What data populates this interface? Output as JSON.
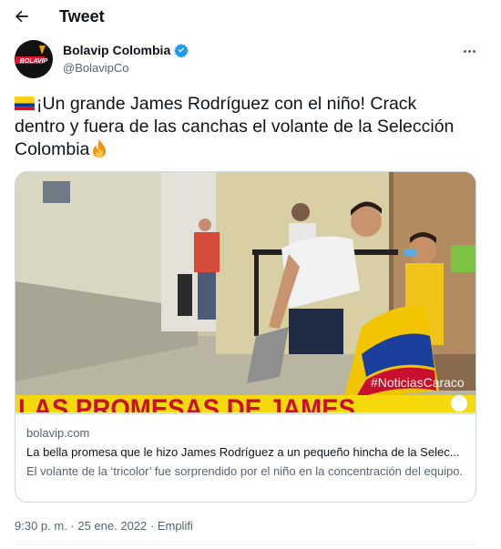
{
  "header": {
    "title": "Tweet",
    "back_icon": "arrow-left-icon"
  },
  "author": {
    "name": "Bolavip Colombia",
    "handle": "@BolavipCo",
    "verified_icon": "verified-badge-icon",
    "avatar_text": "BOLAVIP",
    "colors": {
      "verified": "#1d9bf0",
      "avatar_bg": "#111111",
      "avatar_accent": "#e0a400"
    }
  },
  "tweet": {
    "text_part1": "¡Un grande James Rodríguez con el niño! Crack dentro y fuera de las canchas el volante de la Selección Colombia",
    "flag_icon": "colombia-flag-icon",
    "fire_icon": "fire-icon"
  },
  "card": {
    "domain": "bolavip.com",
    "title": "La bella promesa que le hizo James Rodríguez a un pequeño hincha de la Selec...",
    "description": "El volante de la ‘tricolor’ fue sorprendido por el niño en la concentración del equipo.",
    "media": {
      "banner_text": "LAS PROMESAS DE JAMES",
      "watermark": "#NoticiasCaraco",
      "colors": {
        "banner": "#f5d90a",
        "banner_text": "#c8102e"
      }
    }
  },
  "timestamp": "9:30 p. m. · 25 ene. 2022 · Emplifi"
}
